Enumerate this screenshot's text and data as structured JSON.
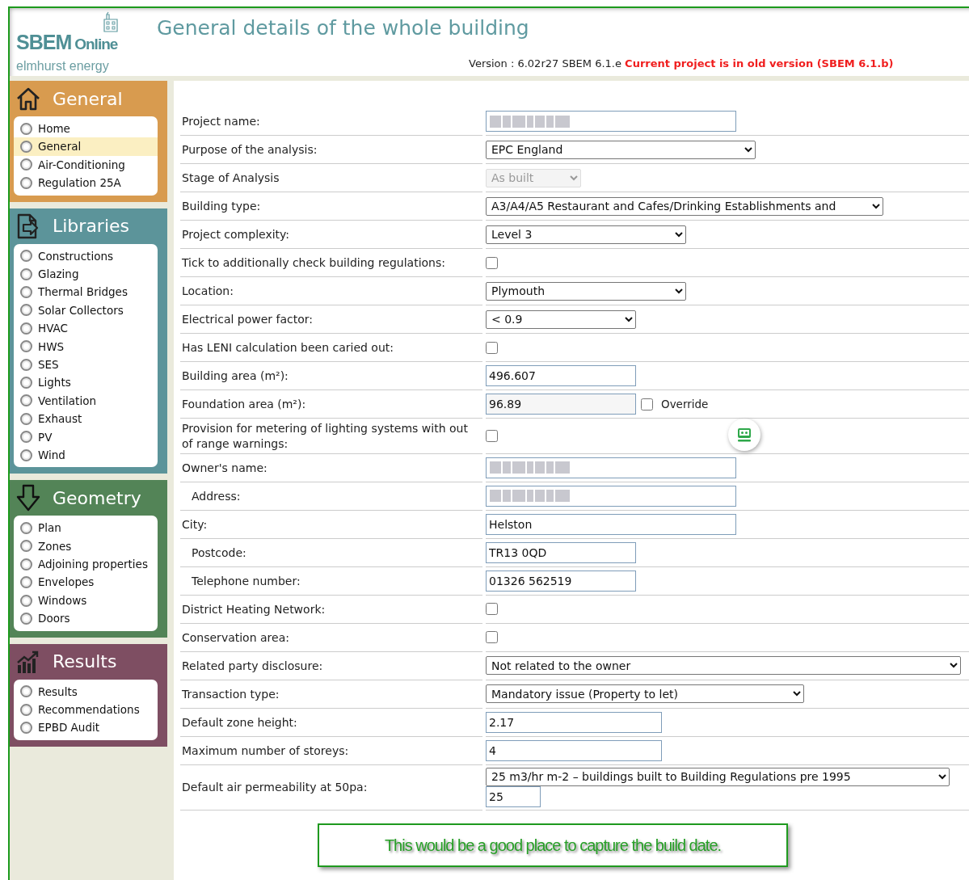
{
  "header": {
    "brand": "SBEM",
    "brand_suffix": "Online",
    "company": "elmhurst energy",
    "title": "General details of the whole building",
    "version": "Version : 6.02r27 SBEM 6.1.e",
    "warning": "Current project is in old version (SBEM 6.1.b)"
  },
  "sidebar": {
    "sections": [
      {
        "title": "General",
        "color": "#d89b4f",
        "items": [
          {
            "label": "Home",
            "selected": false
          },
          {
            "label": "General",
            "selected": true
          },
          {
            "label": "Air-Conditioning",
            "selected": false
          },
          {
            "label": "Regulation 25A",
            "selected": false
          }
        ]
      },
      {
        "title": "Libraries",
        "color": "#5c949a",
        "items": [
          {
            "label": "Constructions",
            "selected": false
          },
          {
            "label": "Glazing",
            "selected": false
          },
          {
            "label": "Thermal Bridges",
            "selected": false
          },
          {
            "label": "Solar Collectors",
            "selected": false
          },
          {
            "label": "HVAC",
            "selected": false
          },
          {
            "label": "HWS",
            "selected": false
          },
          {
            "label": "SES",
            "selected": false
          },
          {
            "label": "Lights",
            "selected": false
          },
          {
            "label": "Ventilation",
            "selected": false
          },
          {
            "label": "Exhaust",
            "selected": false
          },
          {
            "label": "PV",
            "selected": false
          },
          {
            "label": "Wind",
            "selected": false
          }
        ]
      },
      {
        "title": "Geometry",
        "color": "#538457",
        "items": [
          {
            "label": "Plan",
            "selected": false
          },
          {
            "label": "Zones",
            "selected": false
          },
          {
            "label": "Adjoining properties",
            "selected": false
          },
          {
            "label": "Envelopes",
            "selected": false
          },
          {
            "label": "Windows",
            "selected": false
          },
          {
            "label": "Doors",
            "selected": false
          }
        ]
      },
      {
        "title": "Results",
        "color": "#7e4e62",
        "items": [
          {
            "label": "Results",
            "selected": false
          },
          {
            "label": "Recommendations",
            "selected": false
          },
          {
            "label": "EPBD Audit",
            "selected": false
          }
        ]
      }
    ]
  },
  "form": {
    "rows": [
      {
        "label": "Project name:",
        "controls": [
          {
            "kind": "text",
            "blurred": true
          }
        ]
      },
      {
        "label": "Purpose of the analysis:",
        "controls": [
          {
            "kind": "select",
            "value": "EPC England",
            "disabled": false
          }
        ]
      },
      {
        "label": "Stage of Analysis",
        "controls": [
          {
            "kind": "select",
            "value": "As built",
            "disabled": true
          }
        ]
      },
      {
        "label": "Building type:",
        "controls": [
          {
            "kind": "select",
            "value": "A3/A4/A5 Restaurant and Cafes/Drinking Establishments and",
            "disabled": false
          }
        ]
      },
      {
        "label": "Project complexity:",
        "controls": [
          {
            "kind": "select",
            "value": "Level 3",
            "disabled": false
          }
        ]
      },
      {
        "label": "Tick to additionally check building regulations:",
        "controls": [
          {
            "kind": "checkbox",
            "checked": false
          }
        ]
      },
      {
        "label": "Location:",
        "controls": [
          {
            "kind": "select",
            "value": "Plymouth",
            "disabled": false
          }
        ]
      },
      {
        "label": "Electrical power factor:",
        "controls": [
          {
            "kind": "select",
            "value": "< 0.9",
            "disabled": false
          }
        ]
      },
      {
        "label": "Has LENI calculation been caried out:",
        "controls": [
          {
            "kind": "checkbox",
            "checked": false
          }
        ]
      },
      {
        "label": "Building area (m²):",
        "controls": [
          {
            "kind": "text",
            "value": "496.607"
          }
        ]
      },
      {
        "label": "Foundation area (m²):",
        "controls": [
          {
            "kind": "text",
            "value": "96.89",
            "readonly": true
          },
          {
            "kind": "checkbox",
            "checked": false,
            "label": "Override"
          }
        ]
      },
      {
        "label": "Provision for metering of lighting systems with out of range warnings:",
        "controls": [
          {
            "kind": "checkbox",
            "checked": false
          }
        ]
      },
      {
        "label": "Owner's name:",
        "controls": [
          {
            "kind": "text",
            "blurred": true
          }
        ]
      },
      {
        "label": "Address:",
        "indented": true,
        "controls": [
          {
            "kind": "text",
            "blurred": true
          }
        ]
      },
      {
        "label": "City:",
        "controls": [
          {
            "kind": "text",
            "value": "Helston"
          }
        ]
      },
      {
        "label": "Postcode:",
        "indented": true,
        "controls": [
          {
            "kind": "text",
            "value": "TR13 0QD"
          }
        ]
      },
      {
        "label": "Telephone number:",
        "indented": true,
        "controls": [
          {
            "kind": "text",
            "value": "01326 562519"
          }
        ]
      },
      {
        "label": "District Heating Network:",
        "controls": [
          {
            "kind": "checkbox",
            "checked": false
          }
        ]
      },
      {
        "label": "Conservation area:",
        "controls": [
          {
            "kind": "checkbox",
            "checked": false
          }
        ]
      },
      {
        "label": "Related party disclosure:",
        "controls": [
          {
            "kind": "select",
            "value": "Not related to the owner",
            "disabled": false
          }
        ]
      },
      {
        "label": "Transaction type:",
        "controls": [
          {
            "kind": "select",
            "value": "Mandatory issue (Property to let)",
            "disabled": false
          }
        ]
      },
      {
        "label": "Default zone height:",
        "controls": [
          {
            "kind": "text",
            "value": "2.17"
          }
        ]
      },
      {
        "label": "Maximum number of storeys:",
        "controls": [
          {
            "kind": "text",
            "value": "4"
          }
        ]
      },
      {
        "label": "Default air permeability at 50pa:",
        "controls": [
          {
            "kind": "select",
            "value": "25 m3/hr m-2 – buildings built to Building Regulations pre 1995",
            "disabled": false
          },
          {
            "kind": "text",
            "value": "25"
          }
        ]
      }
    ]
  },
  "note": "This would be a good place to capture the build date."
}
